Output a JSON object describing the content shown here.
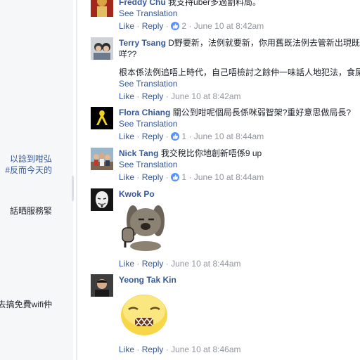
{
  "left_panel": {
    "snippets": [
      {
        "text": "以諗到咁弘",
        "style": "link"
      },
      {
        "text": "#反而今天的",
        "style": "link"
      },
      {
        "text": "話晒服務緊",
        "style": "plain"
      },
      {
        "text": "去搞免費wifi仲",
        "style": "plain"
      }
    ]
  },
  "actions": {
    "like": "Like",
    "reply": "Reply",
    "see_translation": "See Translation",
    "dot": "·"
  },
  "comments": [
    {
      "author": "Freddy Chu",
      "text": "我支持uber多過劏料局。",
      "likes": "2",
      "time": "June 10 at 8:42am"
    },
    {
      "author": "Terry Tsang",
      "text": "D野要新，法例就要新，你用舊既法例去管新出現既",
      "text2": "咩??",
      "text3": "根本係法例追唔上時代，自己唔檢討之餘仲一味話人地犯法，食屎",
      "time": "June 10 at 8:42am"
    },
    {
      "author": "Flora Chiang",
      "text": "關公到咁呢個局長係咪弱智架?重好意思做局長?",
      "likes": "1",
      "time": "June 10 at 8:44am"
    },
    {
      "author": "Nick Tang",
      "text": "我交稅比你地創新唔係9 up",
      "likes": "1",
      "time": "June 10 at 8:44am"
    },
    {
      "author": "Kwok Po",
      "time": "June 10 at 8:44am"
    },
    {
      "author": "Yeong Tak Kin",
      "time": "June 10 at 8:46am"
    }
  ],
  "colors": {
    "link": "#365899",
    "meta": "#90949c",
    "like_badge": "#5890ff"
  }
}
